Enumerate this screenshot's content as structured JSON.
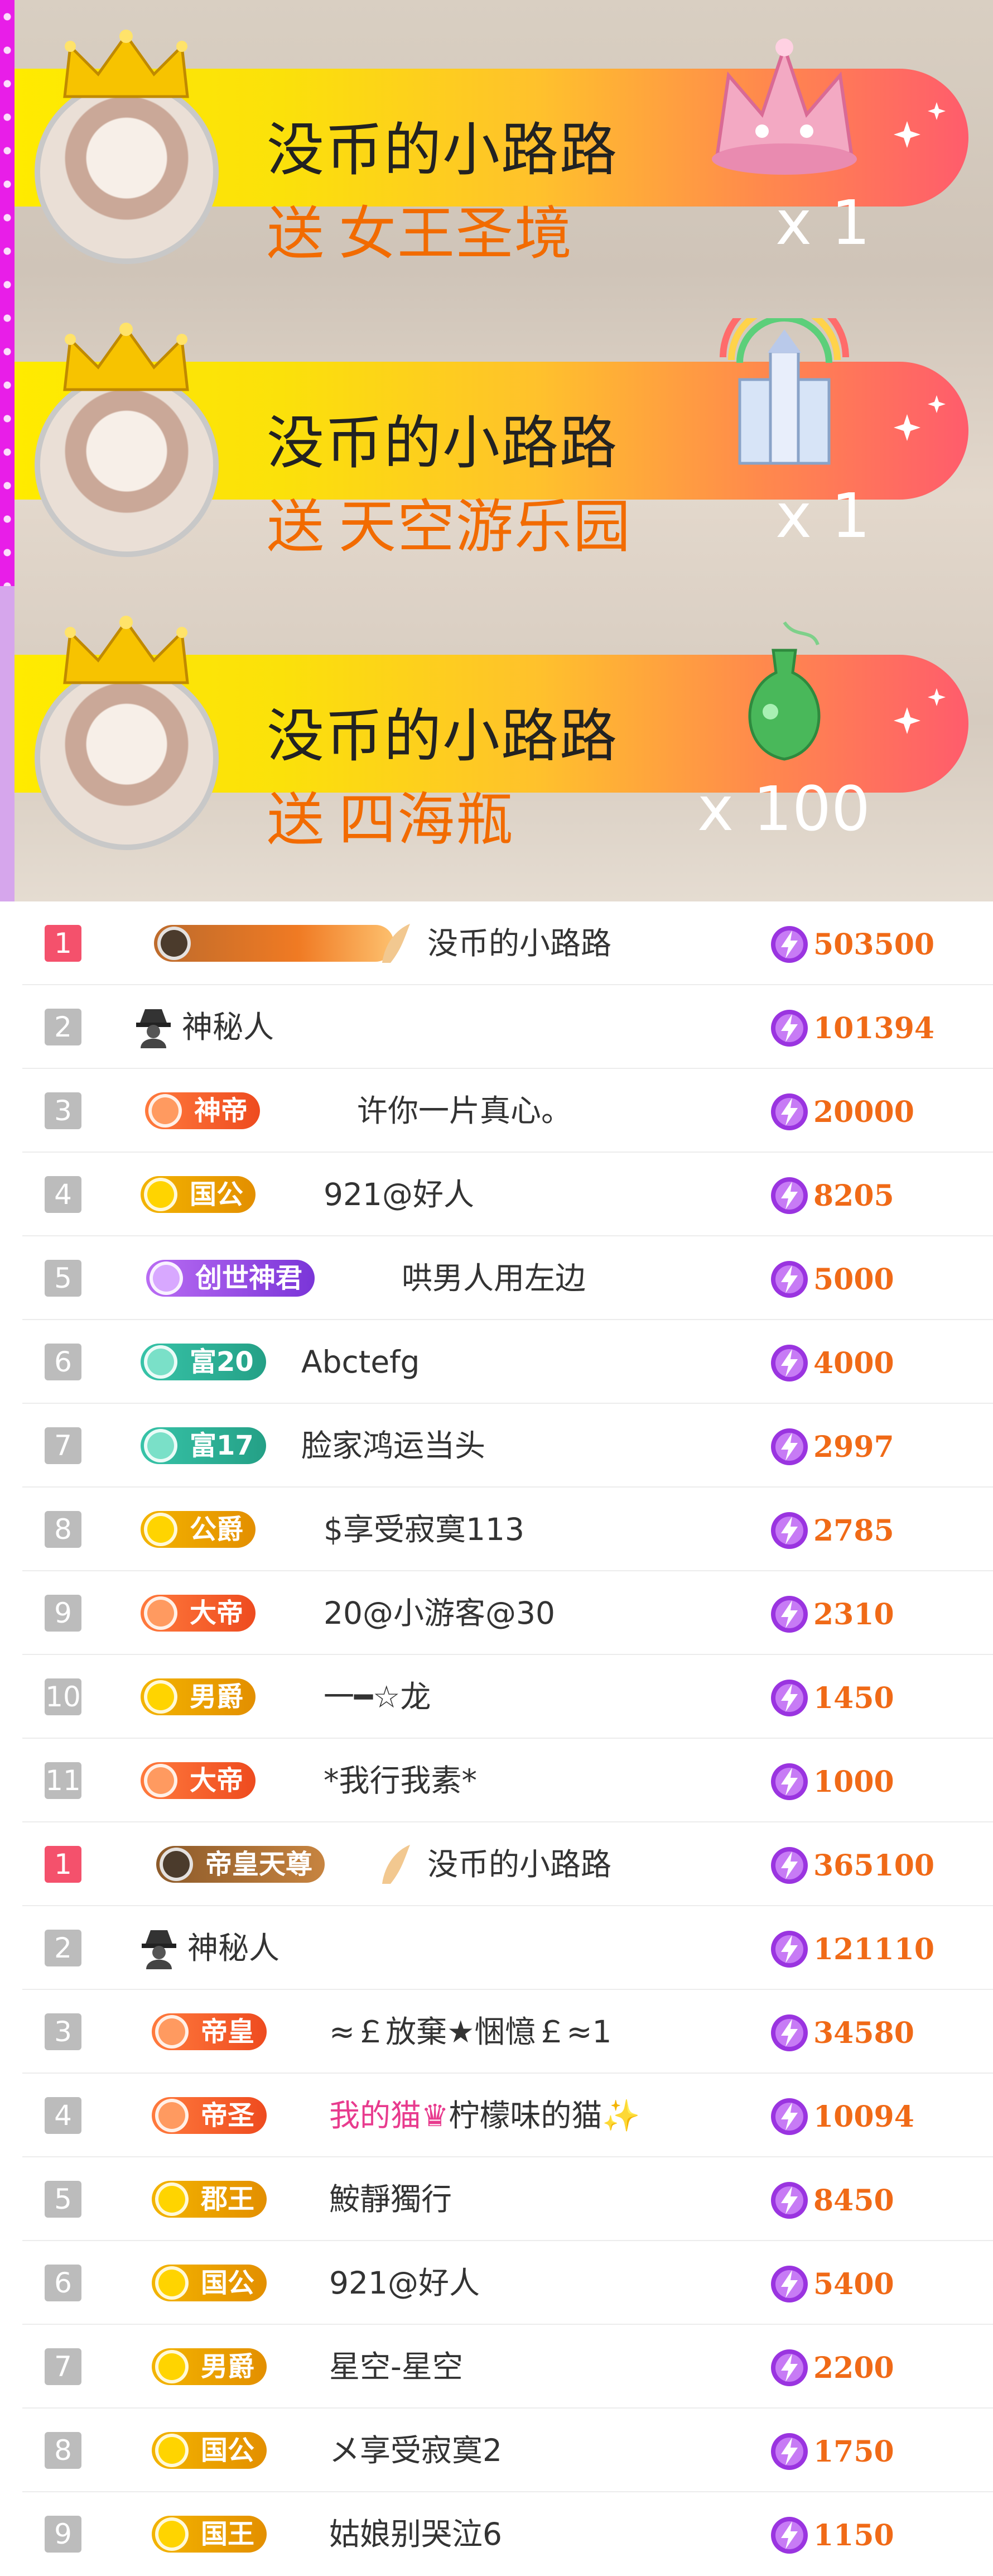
{
  "banners": [
    {
      "name": "没币的小路路",
      "send": "送",
      "gift": "女王圣境",
      "count": "x 1"
    },
    {
      "name": "没币的小路路",
      "send": "送",
      "gift": "天空游乐园",
      "count": "x 1"
    },
    {
      "name": "没币的小路路",
      "send": "送",
      "gift": "四海瓶",
      "count": "x 100"
    }
  ],
  "ranking_1": [
    {
      "rank": "1",
      "badge": "",
      "name": "没币的小路路",
      "score": "503500"
    },
    {
      "rank": "2",
      "badge": "",
      "name": "神秘人",
      "score": "101394"
    },
    {
      "rank": "3",
      "badge": "神帝",
      "name": "许你一片真心。",
      "score": "20000"
    },
    {
      "rank": "4",
      "badge": "国公",
      "name": "921@好人",
      "score": "8205"
    },
    {
      "rank": "5",
      "badge": "创世神君",
      "name": "哄男人用左边",
      "score": "5000"
    },
    {
      "rank": "6",
      "badge": "富20",
      "name": "Abctefg",
      "score": "4000"
    },
    {
      "rank": "7",
      "badge": "富17",
      "name": "脸家鸿运当头",
      "score": "2997"
    },
    {
      "rank": "8",
      "badge": "公爵",
      "name": "$享受寂寞113",
      "score": "2785"
    },
    {
      "rank": "9",
      "badge": "大帝",
      "name": "20@小游客@30",
      "score": "2310"
    },
    {
      "rank": "10",
      "badge": "男爵",
      "name": "一━☆龙",
      "score": "1450"
    },
    {
      "rank": "11",
      "badge": "大帝",
      "name": "*我行我素*",
      "score": "1000"
    }
  ],
  "ranking_2": [
    {
      "rank": "1",
      "badge": "帝皇天尊",
      "name": "没币的小路路",
      "score": "365100"
    },
    {
      "rank": "2",
      "badge": "",
      "name": "神秘人",
      "score": "121110"
    },
    {
      "rank": "3",
      "badge": "帝皇",
      "name": "≈￡放棄★悃憶￡≈1",
      "score": "34580"
    },
    {
      "rank": "4",
      "badge": "帝圣",
      "name_pink": "我的猫",
      "name_rest": "柠檬味的猫",
      "score": "10094"
    },
    {
      "rank": "5",
      "badge": "郡王",
      "name": "鮟靜獨行",
      "score": "8450"
    },
    {
      "rank": "6",
      "badge": "国公",
      "name": "921@好人",
      "score": "5400"
    },
    {
      "rank": "7",
      "badge": "男爵",
      "name": "星空-星空",
      "score": "2200"
    },
    {
      "rank": "8",
      "badge": "国公",
      "name": "メ享受寂寞2",
      "score": "1750"
    },
    {
      "rank": "9",
      "badge": "国王",
      "name": "姑娘别哭泣6",
      "score": "1150"
    }
  ],
  "colors": {
    "accent_orange": "#f06a17",
    "rank_first": "#f4516c",
    "banner_yellow": "#ffeb00",
    "banner_pink": "#ff5c6c"
  },
  "icons": {
    "score": "lightning-bolt-icon",
    "mystery": "spy-hat-icon",
    "banner": "gold-crown-icon"
  }
}
